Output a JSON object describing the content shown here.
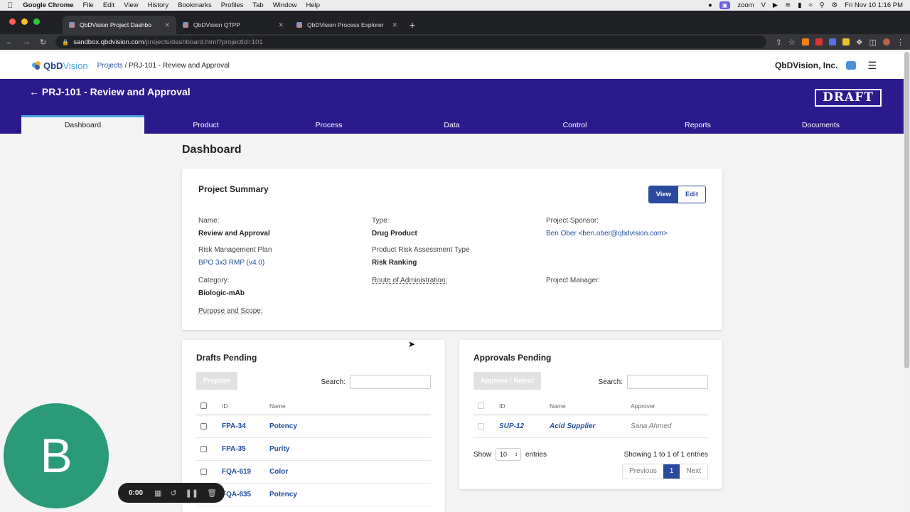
{
  "macbar": {
    "app": "Google Chrome",
    "menus": [
      "File",
      "Edit",
      "View",
      "History",
      "Bookmarks",
      "Profiles",
      "Tab",
      "Window",
      "Help"
    ],
    "zoom": "zoom",
    "datetime": "Fri Nov 10  1:16 PM"
  },
  "browser": {
    "tabs": [
      {
        "title": "QbDVision Project Dashbo"
      },
      {
        "title": "QbDVision QTPP"
      },
      {
        "title": "QbDVision Process Explorer"
      }
    ],
    "url_host": "sandbox.qbdvision.com",
    "url_path": "/projects/dashboard.html?projectId=101"
  },
  "header": {
    "logo_qbd": "QbD",
    "logo_vision": "Vision",
    "crumb_link": "Projects",
    "crumb_sep": " / ",
    "crumb_current": "PRJ-101 - Review and Approval",
    "company": "QbDVision, Inc."
  },
  "band": {
    "title": "← PRJ-101 - Review and Approval",
    "stamp": "DRAFT",
    "tabs": [
      "Dashboard",
      "Product",
      "Process",
      "Data",
      "Control",
      "Reports",
      "Documents"
    ]
  },
  "page": {
    "title": "Dashboard"
  },
  "summary": {
    "heading": "Project Summary",
    "view_label": "View",
    "edit_label": "Edit",
    "fields": {
      "name_label": "Name:",
      "name_value": "Review and Approval",
      "type_label": "Type:",
      "type_value": "Drug Product",
      "sponsor_label": "Project Sponsor:",
      "sponsor_value": "Ben Ober <ben.ober@qbdvision.com>",
      "rmp_label": "Risk Management Plan",
      "rmp_value": "BPO 3x3 RMP (v4.0)",
      "pra_label": "Product Risk Assessment Type",
      "pra_value": "Risk Ranking",
      "category_label": "Category:",
      "category_value": "Biologic-mAb",
      "route_label": "Route of Administration:",
      "manager_label": "Project Manager:",
      "purpose_label": "Purpose and Scope:"
    }
  },
  "drafts": {
    "heading": "Drafts Pending",
    "button": "Propose",
    "search_label": "Search:",
    "columns": [
      "ID",
      "Name"
    ],
    "rows": [
      {
        "id": "FPA-34",
        "name": "Potency"
      },
      {
        "id": "FPA-35",
        "name": "Purity"
      },
      {
        "id": "FQA-619",
        "name": "Color"
      },
      {
        "id": "FQA-635",
        "name": "Potency"
      }
    ]
  },
  "approvals": {
    "heading": "Approvals Pending",
    "button": "Approve / Reject",
    "search_label": "Search:",
    "columns": [
      "ID",
      "Name",
      "Approver"
    ],
    "rows": [
      {
        "id": "SUP-12",
        "name": "Acid Supplier",
        "approver": "Sana Ahmed"
      }
    ],
    "show_label": "Show",
    "page_size": "10",
    "entries_label": "entries",
    "info": "Showing 1 to 1 of 1 entries",
    "prev": "Previous",
    "page": "1",
    "next": "Next"
  },
  "overlay": {
    "avatar_letter": "B",
    "timer": "0:00"
  },
  "colors": {
    "band": "#2a1a8c",
    "accent": "#2a4a9e",
    "link": "#1f4e9e",
    "avatar": "#2a9a78"
  }
}
